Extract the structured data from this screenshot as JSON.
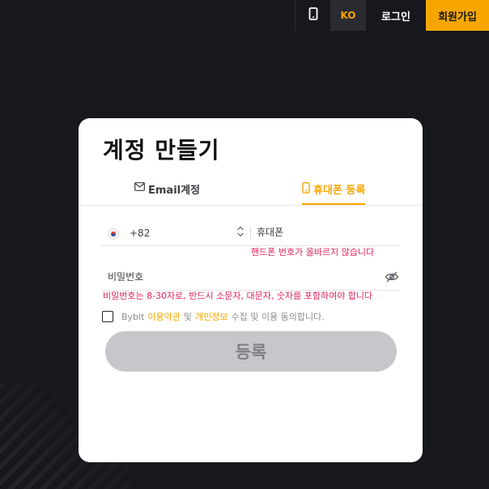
{
  "nav": {
    "phone_icon": "phone-icon",
    "lang": "KO",
    "login": "로그인",
    "signup": "회원가입",
    "accent_color": "#f7a600"
  },
  "card": {
    "title": "계정 만들기",
    "tabs": [
      {
        "label": "Email계정",
        "icon": "mail-icon",
        "active": false
      },
      {
        "label": "휴대폰 등록",
        "icon": "phone-icon",
        "active": true
      }
    ],
    "phone": {
      "flag_icon": "korea-flag-icon",
      "country_code": "+82",
      "placeholder": "휴대폰",
      "error": "핸드폰 번호가 올바르지 않습니다"
    },
    "password": {
      "placeholder": "비밀번호",
      "error": "비밀번호는 8-30자로, 반드시 소문자, 대문자, 숫자를 포함하여야 합니다"
    },
    "agreement": {
      "prefix": "Bybit",
      "terms_link": "이용약관",
      "and": "및",
      "privacy_link": "개인정보",
      "suffix": "수집 및 이용 동의합니다.",
      "checked": false
    },
    "submit_label": "등록",
    "error_color": "#e0245e"
  }
}
